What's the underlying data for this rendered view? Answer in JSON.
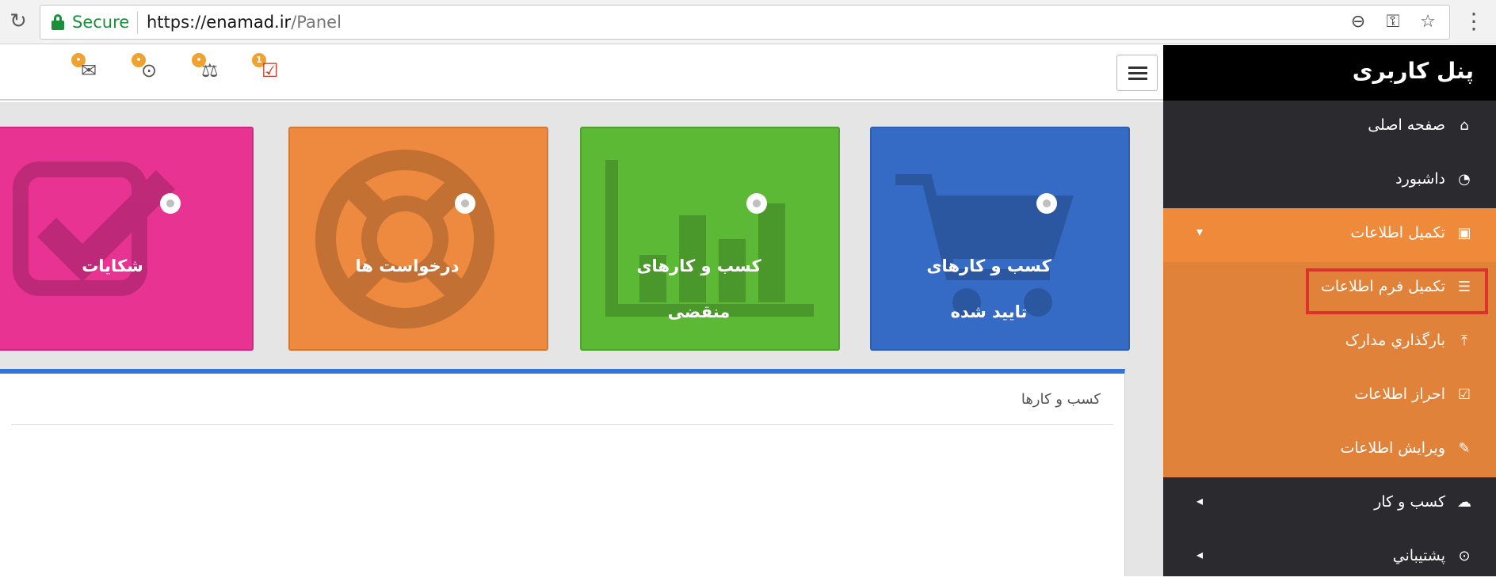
{
  "browser": {
    "secure_label": "Secure",
    "url_scheme": "https://",
    "url_host": "enamad.ir",
    "url_path": "/Panel",
    "icons": [
      "reload-icon",
      "zoom-out-icon",
      "key-icon",
      "star-icon",
      "menu-kebab-icon"
    ]
  },
  "topbar": {
    "notifications": [
      {
        "name": "messages",
        "icon": "envelope-open-icon",
        "badge": ""
      },
      {
        "name": "support",
        "icon": "life-ring-icon",
        "badge": ""
      },
      {
        "name": "complaints",
        "icon": "balance-scale-icon",
        "badge": ""
      },
      {
        "name": "calendar",
        "icon": "calendar-check-icon",
        "badge": "1"
      }
    ]
  },
  "sidebar": {
    "title": "پنل کاربری",
    "items": [
      {
        "label": "صفحه اصلی",
        "icon": "home-icon"
      },
      {
        "label": "داشبورد",
        "icon": "dashboard-icon"
      },
      {
        "label": "تکمیل اطلاعات",
        "icon": "id-card-icon",
        "active": true,
        "expanded": true
      }
    ],
    "subitems": [
      {
        "label": "تکمیل فرم اطلاعات",
        "icon": "list-icon",
        "highlighted": true
      },
      {
        "label": "بارگذاري مدارک",
        "icon": "upload-icon"
      },
      {
        "label": "احراز اطلاعات",
        "icon": "check-square-icon"
      },
      {
        "label": "ویرایش اطلاعات",
        "icon": "edit-icon"
      }
    ],
    "more": [
      {
        "label": "کسب و کار",
        "icon": "cloud-icon"
      },
      {
        "label": "پشتيباني",
        "icon": "life-ring-icon"
      }
    ]
  },
  "tiles": [
    {
      "label_line1": "شکایات",
      "label_line2": "",
      "color": "#e83393",
      "icon": "check-square-icon"
    },
    {
      "label_line1": "درخواست ها",
      "label_line2": "",
      "color": "#ee8a3f",
      "icon": "life-ring-icon"
    },
    {
      "label_line1": "کسب و کارهای",
      "label_line2": "منقضی",
      "color": "#5bb936",
      "icon": "bar-chart-icon"
    },
    {
      "label_line1": "کسب و کارهای",
      "label_line2": "تایید شده",
      "color": "#356bc4",
      "icon": "shopping-cart-icon"
    }
  ],
  "panel": {
    "title": "کسب و کارها",
    "accent": "#3574d4"
  },
  "colors": {
    "sidebar_bg": "#2b2b2f",
    "sidebar_active": "#ee8a3a",
    "sidebar_sub": "#e0823a",
    "highlight_border": "#d9332b"
  }
}
